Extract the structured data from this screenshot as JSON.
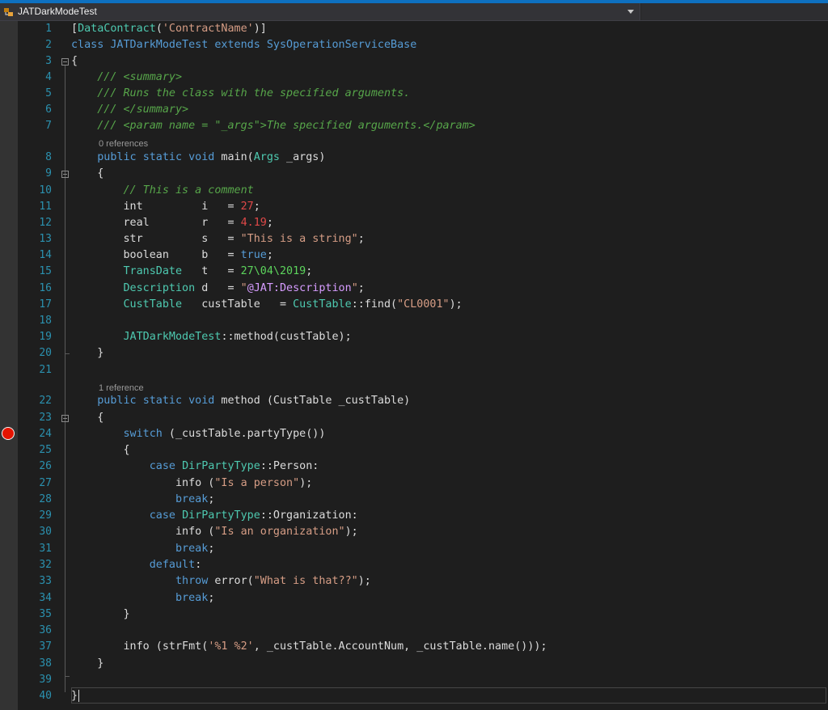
{
  "window": {
    "file_tab": "JATDarkModeTest",
    "member_dropdown": ""
  },
  "codelens": {
    "main": "0 references",
    "method": "1 reference"
  },
  "colors": {
    "keyword": "#569cd6",
    "type": "#4ec9b0",
    "string": "#d69d85",
    "number": "#e04848",
    "date": "#5cd45c",
    "comment": "#57a64a",
    "label": "#d69cff",
    "line_number": "#2b91af",
    "breakpoint": "#e51400"
  },
  "editor": {
    "line_numbers": [
      "1",
      "2",
      "3",
      "4",
      "5",
      "6",
      "7",
      "8",
      "9",
      "10",
      "11",
      "12",
      "13",
      "14",
      "15",
      "16",
      "17",
      "18",
      "19",
      "20",
      "21",
      "22",
      "23",
      "24",
      "25",
      "26",
      "27",
      "28",
      "29",
      "30",
      "31",
      "32",
      "33",
      "34",
      "35",
      "36",
      "37",
      "38",
      "39",
      "40"
    ],
    "tokens": {
      "l1_a": "[",
      "l1_b": "DataContract",
      "l1_c": "(",
      "l1_d": "'ContractName'",
      "l1_e": ")]",
      "l2_a": "class",
      "l2_b": " JATDarkModeTest ",
      "l2_c": "extends",
      "l2_d": " ",
      "l2_e": "SysOperationServiceBase",
      "l3_a": "{",
      "l4_a": "    /// <summary>",
      "l5_a": "    /// Runs the class with the specified arguments.",
      "l6_a": "    /// </summary>",
      "l7_a": "    /// <param name = \"_args\">The specified arguments.</param>",
      "l8_a": "    ",
      "l8_b": "public",
      "l8_c": " ",
      "l8_d": "static",
      "l8_e": " ",
      "l8_f": "void",
      "l8_g": " main(",
      "l8_h": "Args",
      "l8_i": " _args)",
      "l9_a": "    {",
      "l10_a": "        // This is a comment",
      "l11_a": "        int         i   = ",
      "l11_b": "27",
      "l11_c": ";",
      "l12_a": "        real        r   = ",
      "l12_b": "4.19",
      "l12_c": ";",
      "l13_a": "        str         s   = ",
      "l13_b": "\"This is a string\"",
      "l13_c": ";",
      "l14_a": "        boolean     b   = ",
      "l14_b": "true",
      "l14_c": ";",
      "l15_a": "        ",
      "l15_b": "TransDate",
      "l15_c": "   t   = ",
      "l15_d": "27\\04\\2019",
      "l15_e": ";",
      "l16_a": "        ",
      "l16_b": "Description",
      "l16_c": " d   = ",
      "l16_d": "\"",
      "l16_e": "@JAT:Description",
      "l16_f": "\"",
      "l16_g": ";",
      "l17_a": "        ",
      "l17_b": "CustTable",
      "l17_c": "   custTable   = ",
      "l17_d": "CustTable",
      "l17_e": "::find(",
      "l17_f": "\"CL0001\"",
      "l17_g": ");",
      "l19_a": "        ",
      "l19_b": "JATDarkModeTest",
      "l19_c": "::method(custTable);",
      "l20_a": "    }",
      "l22_a": "    ",
      "l22_b": "public",
      "l22_c": " ",
      "l22_d": "static",
      "l22_e": " ",
      "l22_f": "void",
      "l22_g": " method (CustTable _custTable)",
      "l23_a": "    {",
      "l24_a": "        ",
      "l24_b": "switch",
      "l24_c": " (_custTable.partyType())",
      "l25_a": "        {",
      "l26_a": "            ",
      "l26_b": "case",
      "l26_c": " ",
      "l26_d": "DirPartyType",
      "l26_e": "::Person:",
      "l27_a": "                info (",
      "l27_b": "\"Is a person\"",
      "l27_c": ");",
      "l28_a": "                ",
      "l28_b": "break",
      "l28_c": ";",
      "l29_a": "            ",
      "l29_b": "case",
      "l29_c": " ",
      "l29_d": "DirPartyType",
      "l29_e": "::Organization:",
      "l30_a": "                info (",
      "l30_b": "\"Is an organization\"",
      "l30_c": ");",
      "l31_a": "                ",
      "l31_b": "break",
      "l31_c": ";",
      "l32_a": "            ",
      "l32_b": "default",
      "l32_c": ":",
      "l33_a": "                ",
      "l33_b": "throw",
      "l33_c": " error(",
      "l33_d": "\"What is that??\"",
      "l33_e": ");",
      "l34_a": "                ",
      "l34_b": "break",
      "l34_c": ";",
      "l35_a": "        }",
      "l37_a": "        info (strFmt(",
      "l37_b": "'%1 %2'",
      "l37_c": ", _custTable.AccountNum, _custTable.name()));",
      "l38_a": "    }",
      "l40_a": "}"
    }
  }
}
